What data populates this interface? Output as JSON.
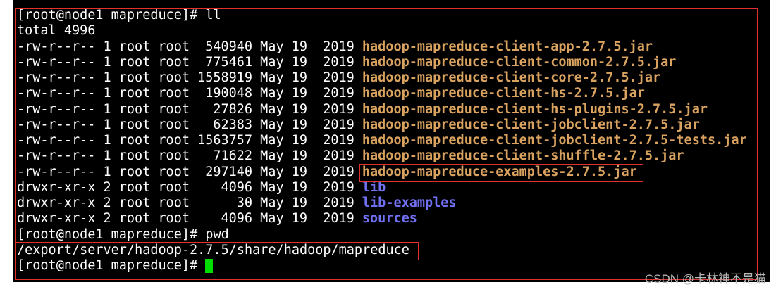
{
  "terminal": {
    "command_1": {
      "prompt": "[root@node1 mapreduce]#",
      "command": "ll"
    },
    "total": "total 4996",
    "listing": [
      {
        "permissions": "-rw-r--r--",
        "links": "1",
        "owner": "root",
        "group": "root",
        "size": "540940",
        "month": "May",
        "day": "19",
        "year": "2019",
        "name": "hadoop-mapreduce-client-app-2.7.5.jar"
      },
      {
        "permissions": "-rw-r--r--",
        "links": "1",
        "owner": "root",
        "group": "root",
        "size": "775461",
        "month": "May",
        "day": "19",
        "year": "2019",
        "name": "hadoop-mapreduce-client-common-2.7.5.jar"
      },
      {
        "permissions": "-rw-r--r--",
        "links": "1",
        "owner": "root",
        "group": "root",
        "size": "1558919",
        "month": "May",
        "day": "19",
        "year": "2019",
        "name": "hadoop-mapreduce-client-core-2.7.5.jar"
      },
      {
        "permissions": "-rw-r--r--",
        "links": "1",
        "owner": "root",
        "group": "root",
        "size": "190048",
        "month": "May",
        "day": "19",
        "year": "2019",
        "name": "hadoop-mapreduce-client-hs-2.7.5.jar"
      },
      {
        "permissions": "-rw-r--r--",
        "links": "1",
        "owner": "root",
        "group": "root",
        "size": "27826",
        "month": "May",
        "day": "19",
        "year": "2019",
        "name": "hadoop-mapreduce-client-hs-plugins-2.7.5.jar"
      },
      {
        "permissions": "-rw-r--r--",
        "links": "1",
        "owner": "root",
        "group": "root",
        "size": "62383",
        "month": "May",
        "day": "19",
        "year": "2019",
        "name": "hadoop-mapreduce-client-jobclient-2.7.5.jar"
      },
      {
        "permissions": "-rw-r--r--",
        "links": "1",
        "owner": "root",
        "group": "root",
        "size": "1563757",
        "month": "May",
        "day": "19",
        "year": "2019",
        "name": "hadoop-mapreduce-client-jobclient-2.7.5-tests.jar"
      },
      {
        "permissions": "-rw-r--r--",
        "links": "1",
        "owner": "root",
        "group": "root",
        "size": "71622",
        "month": "May",
        "day": "19",
        "year": "2019",
        "name": "hadoop-mapreduce-client-shuffle-2.7.5.jar"
      },
      {
        "permissions": "-rw-r--r--",
        "links": "1",
        "owner": "root",
        "group": "root",
        "size": "297140",
        "month": "May",
        "day": "19",
        "year": "2019",
        "name": "hadoop-mapreduce-examples-2.7.5.jar"
      },
      {
        "permissions": "drwxr-xr-x",
        "links": "2",
        "owner": "root",
        "group": "root",
        "size": "4096",
        "month": "May",
        "day": "19",
        "year": "2019",
        "name": "lib"
      },
      {
        "permissions": "drwxr-xr-x",
        "links": "2",
        "owner": "root",
        "group": "root",
        "size": "30",
        "month": "May",
        "day": "19",
        "year": "2019",
        "name": "lib-examples"
      },
      {
        "permissions": "drwxr-xr-x",
        "links": "2",
        "owner": "root",
        "group": "root",
        "size": "4096",
        "month": "May",
        "day": "19",
        "year": "2019",
        "name": "sources"
      }
    ],
    "command_2": {
      "prompt": "[root@node1 mapreduce]#",
      "command": "pwd"
    },
    "pwd_output": "/export/server/hadoop-2.7.5/share/hadoop/mapreduce",
    "command_3": {
      "prompt": "[root@node1 mapreduce]#"
    }
  },
  "watermark": "CSDN @卡林神不是猫",
  "colors": {
    "background": "#000000",
    "foreground": "#ffffff",
    "archive": "#d9a25f",
    "directory": "#7070f5",
    "highlight_box": "#e03030",
    "cursor": "#00dd00"
  }
}
